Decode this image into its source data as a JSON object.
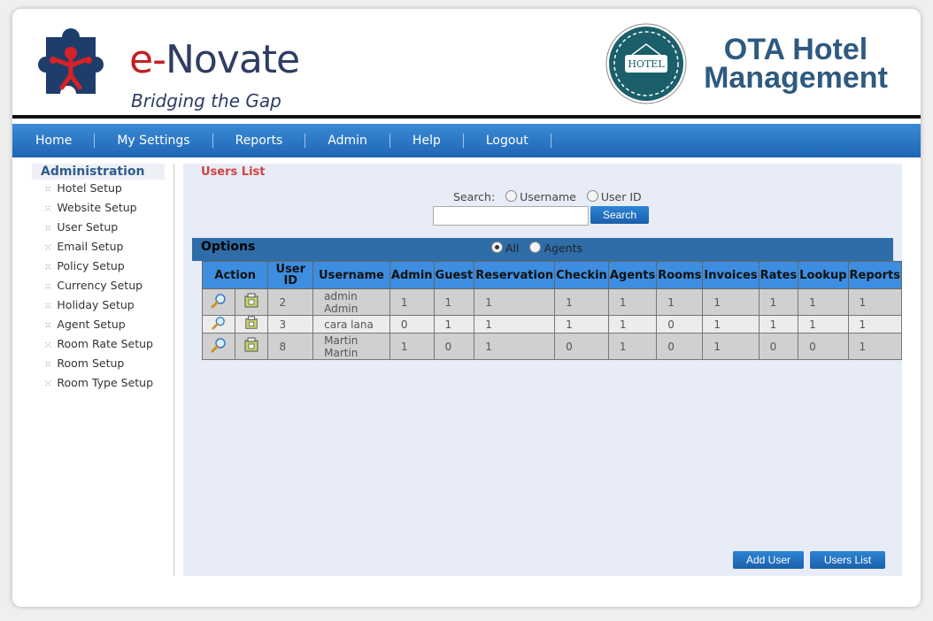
{
  "brand": {
    "name_e": "e-",
    "name_rest": "Novate",
    "tagline": "Bridging the Gap"
  },
  "hotel": {
    "badge_text": "HOTEL",
    "title_line1": "OTA Hotel",
    "title_line2": "Management"
  },
  "nav": [
    "Home",
    "My Settings",
    "Reports",
    "Admin",
    "Help",
    "Logout"
  ],
  "sidebar": {
    "heading": "Administration",
    "items": [
      "Hotel Setup",
      "Website Setup",
      "User Setup",
      "Email Setup",
      "Policy Setup",
      "Currency Setup",
      "Holiday Setup",
      "Agent Setup",
      "Room Rate Setup",
      "Room Setup",
      "Room Type Setup"
    ]
  },
  "main": {
    "title": "Users List",
    "search": {
      "label": "Search:",
      "opt_username": "Username",
      "opt_userid": "User ID",
      "value": "",
      "button": "Search"
    },
    "options": {
      "label": "Options",
      "opt_all": "All",
      "opt_agents": "Agents",
      "selected": "All"
    },
    "table": {
      "headers": [
        "Action",
        "User ID",
        "Username",
        "Admin",
        "Guest",
        "Reservation",
        "Checkin",
        "Agents",
        "Rooms",
        "Invoices",
        "Rates",
        "Lookup",
        "Reports"
      ],
      "rows": [
        {
          "id": "2",
          "username_l1": "admin",
          "username_l2": "Admin",
          "vals": [
            "1",
            "1",
            "1",
            "1",
            "1",
            "1",
            "1",
            "1",
            "1",
            "1"
          ]
        },
        {
          "id": "3",
          "username_l1": "cara lana",
          "username_l2": "",
          "vals": [
            "0",
            "1",
            "1",
            "1",
            "1",
            "0",
            "1",
            "1",
            "1",
            "1"
          ]
        },
        {
          "id": "8",
          "username_l1": "Martin",
          "username_l2": "Martin",
          "vals": [
            "1",
            "0",
            "1",
            "0",
            "1",
            "0",
            "1",
            "0",
            "0",
            "1"
          ]
        }
      ]
    },
    "buttons": {
      "add_user": "Add User",
      "users_list": "Users List"
    }
  },
  "colors": {
    "nav_blue": "#1e66b3",
    "accent_red": "#c21f24",
    "brand_navy": "#2e3d63",
    "title_red": "#d0433f"
  }
}
